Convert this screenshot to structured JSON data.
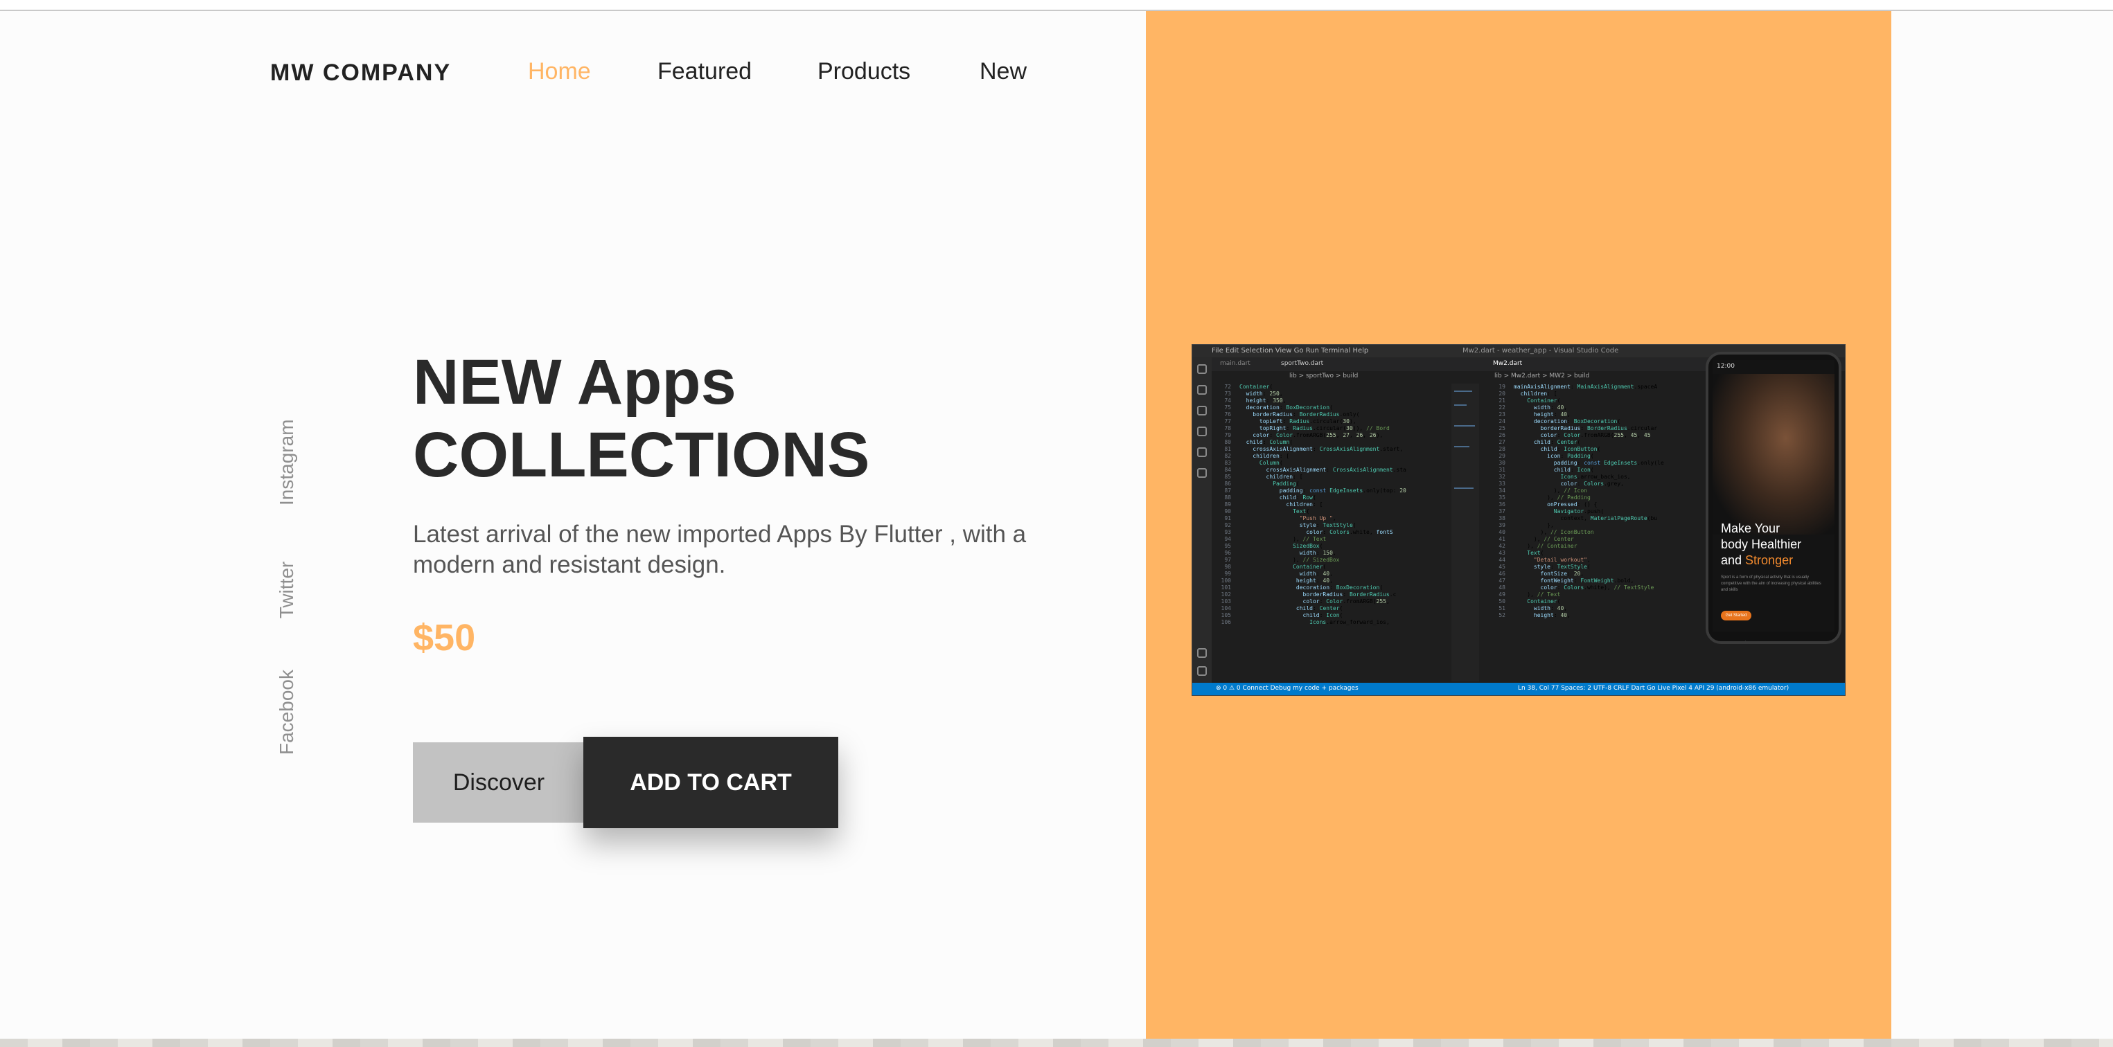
{
  "colors": {
    "accent": "#ffb564",
    "dark": "#2a2a2a",
    "discover_bg": "#c2c2c2"
  },
  "brand": {
    "name": "MW COMPANY"
  },
  "nav": {
    "items": [
      {
        "label": "Home",
        "active": true
      },
      {
        "label": "Featured",
        "active": false
      },
      {
        "label": "Products",
        "active": false
      },
      {
        "label": "New",
        "active": false
      }
    ]
  },
  "social": {
    "instagram": "Instagram",
    "twitter": "Twitter",
    "facebook": "Facebook"
  },
  "hero": {
    "title_line1": "NEW Apps",
    "title_line2": "COLLECTIONS",
    "description": "Latest arrival of the new imported Apps By Flutter , with a modern and resistant design.",
    "price": "$50",
    "discover_label": "Discover",
    "cart_label": "ADD TO CART"
  },
  "ide": {
    "menu": "File  Edit  Selection  View  Go  Run  Terminal  Help",
    "window_title": "Mw2.dart - weather_app - Visual Studio Code",
    "tab_left_1": "main.dart",
    "tab_left_2": "sportTwo.dart",
    "tab_right": "Mw2.dart",
    "breadcrumb_left": "lib > sportTwo > build",
    "breadcrumb_right": "lib > Mw2.dart > MW2 > build",
    "status_left": "⊗ 0 ⚠ 0  Connect   Debug my code + packages",
    "status_right": "Ln 38, Col 77   Spaces: 2   UTF-8   CRLF   Dart   Go Live   Pixel 4 API 29 (android-x86 emulator)"
  },
  "phone": {
    "status": "12:00",
    "title_1": "Make Your",
    "title_2": "body Healthier",
    "title_3_prefix": "and ",
    "title_3_highlight": "Stronger",
    "body": "Sport is a form of physical activity that is usually competitive with the aim of increasing physical abilities and skills",
    "button": "Get Started"
  }
}
